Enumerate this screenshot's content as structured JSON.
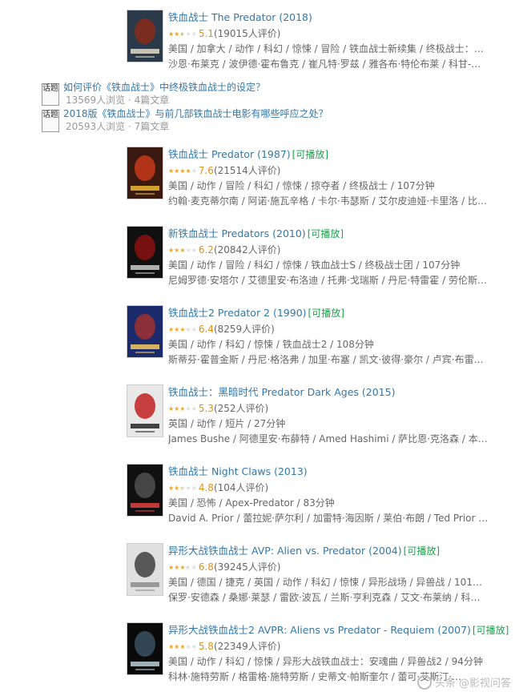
{
  "items": [
    {
      "title": "铁血战士 The Predator (2018)",
      "playable": "",
      "rating": 0.51,
      "score": "5.1",
      "votes": "(19015人评价)",
      "meta1": "美国 / 加拿大 / 动作 / 科幻 / 惊悚 / 冒险 / 铁血战士新续集 / 终极战士：掠…",
      "meta2": "沙恩·布莱克 / 波伊德·霍布鲁克 / 崔凡特·罗兹 / 雅各布·特伦布莱 / 科甘-迈…",
      "poster_colors": [
        "#2a3a4a",
        "#8a2a1a",
        "#d8d0c0"
      ]
    },
    {
      "title": "铁血战士 Predator (1987)",
      "playable": "[可播放]",
      "rating": 0.76,
      "score": "7.6",
      "votes": "(21514人评价)",
      "meta1": "美国 / 动作 / 冒险 / 科幻 / 惊悚 / 掠夺者 / 终极战士 / 107分钟",
      "meta2": "约翰·麦克蒂尔南 / 阿诺·施瓦辛格 / 卡尔·韦瑟斯 / 艾尔皮迪娅·卡里洛 / 比…",
      "poster_colors": [
        "#3a1a10",
        "#c83a1a",
        "#e0b030"
      ]
    },
    {
      "title": "新铁血战士 Predators (2010)",
      "playable": "[可播放]",
      "rating": 0.62,
      "score": "6.2",
      "votes": "(20842人评价)",
      "meta1": "美国 / 动作 / 冒险 / 科幻 / 惊悚 / 铁血战士S / 终极战士团 / 107分钟",
      "meta2": "尼姆罗德·安塔尔 / 艾德里安·布洛迪 / 托弗·戈瑞斯 / 丹尼·特雷霍 / 劳伦斯·…",
      "poster_colors": [
        "#101010",
        "#8a1010",
        "#c0c0c0"
      ]
    },
    {
      "title": "铁血战士2 Predator 2 (1990)",
      "playable": "[可播放]",
      "rating": 0.64,
      "score": "6.4",
      "votes": "(8259人评价)",
      "meta1": "美国 / 动作 / 科幻 / 惊悚 / 铁血战士2 / 108分钟",
      "meta2": "斯蒂芬·霍普金斯 / 丹尼·格洛弗 / 加里·布塞 / 凯文·彼得·豪尔 / 卢宾·布雷…",
      "poster_colors": [
        "#1a2a6a",
        "#a03030",
        "#e8c060"
      ]
    },
    {
      "title": "铁血战士：黑暗时代 Predator Dark Ages (2015)",
      "playable": "",
      "rating": 0.53,
      "score": "5.3",
      "votes": "(252人评价)",
      "meta1": "英国 / 动作 / 短片 / 27分钟",
      "meta2": "James Bushe / 阿德里安·布薛特 / Amed Hashimi / 萨比恩·克洛森 / 本·…",
      "poster_colors": [
        "#e8e8e8",
        "#c02020",
        "#303030"
      ]
    },
    {
      "title": "铁血战士 Night Claws (2013)",
      "playable": "",
      "rating": 0.48,
      "score": "4.8",
      "votes": "(104人评价)",
      "meta1": "美国 / 恐怖 / Apex-Predator / 83分钟",
      "meta2": "David A. Prior / 蕾拉妮·萨尔利 / 加雷特·海因斯 / 莱伯·布朗 / Ted Prior / S…",
      "poster_colors": [
        "#101010",
        "#505050",
        "#d04040"
      ]
    },
    {
      "title": "异形大战铁血战士 AVP: Alien vs. Predator (2004)",
      "playable": "[可播放]",
      "rating": 0.68,
      "score": "6.8",
      "votes": "(39245人评价)",
      "meta1": "美国 / 德国 / 捷克 / 英国 / 动作 / 科幻 / 惊悚 / 异形战场 / 异兽战 / 101分钟",
      "meta2": "保罗·安德森 / 桑娜·莱瑟 / 雷欧·波瓦 / 兰斯·亨利克森 / 艾文·布莱纳 / 科林·…",
      "poster_colors": [
        "#e0e0e0",
        "#404040",
        "#909090"
      ]
    },
    {
      "title": "异形大战铁血战士2 AVPR: Aliens vs Predator - Requiem (2007)",
      "playable": "[可播放]",
      "rating": 0.58,
      "score": "5.8",
      "votes": "(22349人评价)",
      "meta1": "美国 / 动作 / 科幻 / 惊悚 / 异形大战铁血战士：安魂曲 / 异兽战2 / 94分钟",
      "meta2": "科林·施特劳斯 / 格雷格·施特劳斯 / 史蒂文·帕斯奎尔 / 蕾可·艾斯汀·…",
      "poster_colors": [
        "#0a0a0a",
        "#3a5060",
        "#b0c0c8"
      ]
    }
  ],
  "topics": [
    {
      "badge": "话题",
      "question": "如何评价《铁血战士》中终极铁血战士的设定？",
      "stats": "13569人浏览 · 4篇文章"
    },
    {
      "badge": "话题",
      "question": "2018版《铁血战士》与前几部铁血战士电影有哪些呼应之处？",
      "stats": "20593人浏览 · 7篇文章"
    }
  ],
  "watermark": "头条 @影视问答"
}
